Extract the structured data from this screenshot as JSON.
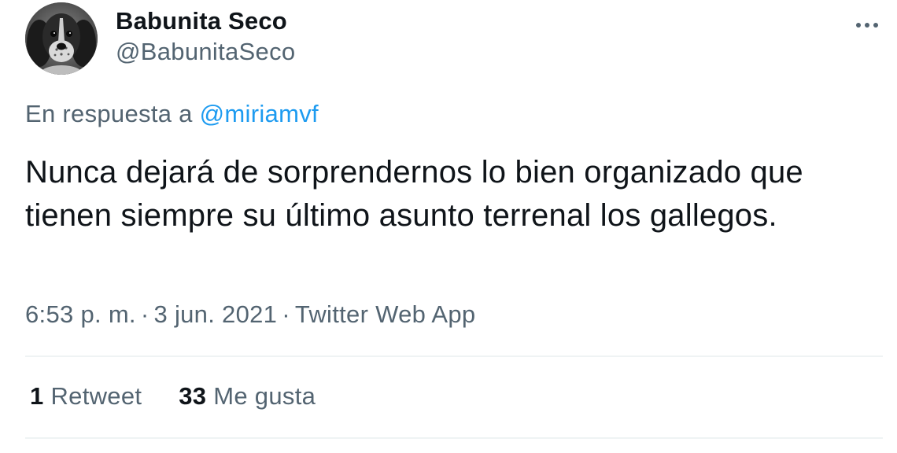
{
  "author": {
    "display_name": "Babunita Seco",
    "handle": "@BabunitaSeco",
    "avatar_icon": "dog-avatar"
  },
  "reply": {
    "prefix": "En respuesta a",
    "mention": "@miriamvf"
  },
  "tweet": {
    "text": "Nunca dejará de sorprendernos lo bien organizado que tienen siempre su último asunto terrenal los gallegos."
  },
  "meta": {
    "time": "6:53 p. m.",
    "separator": "·",
    "date": "3 jun. 2021",
    "source": "Twitter Web App"
  },
  "stats": {
    "retweets_count": "1",
    "retweets_label": "Retweet",
    "likes_count": "33",
    "likes_label": "Me gusta"
  },
  "colors": {
    "link": "#1d9bf0",
    "secondary_text": "#536471",
    "primary_text": "#0f1419",
    "divider": "#eff3f4"
  }
}
